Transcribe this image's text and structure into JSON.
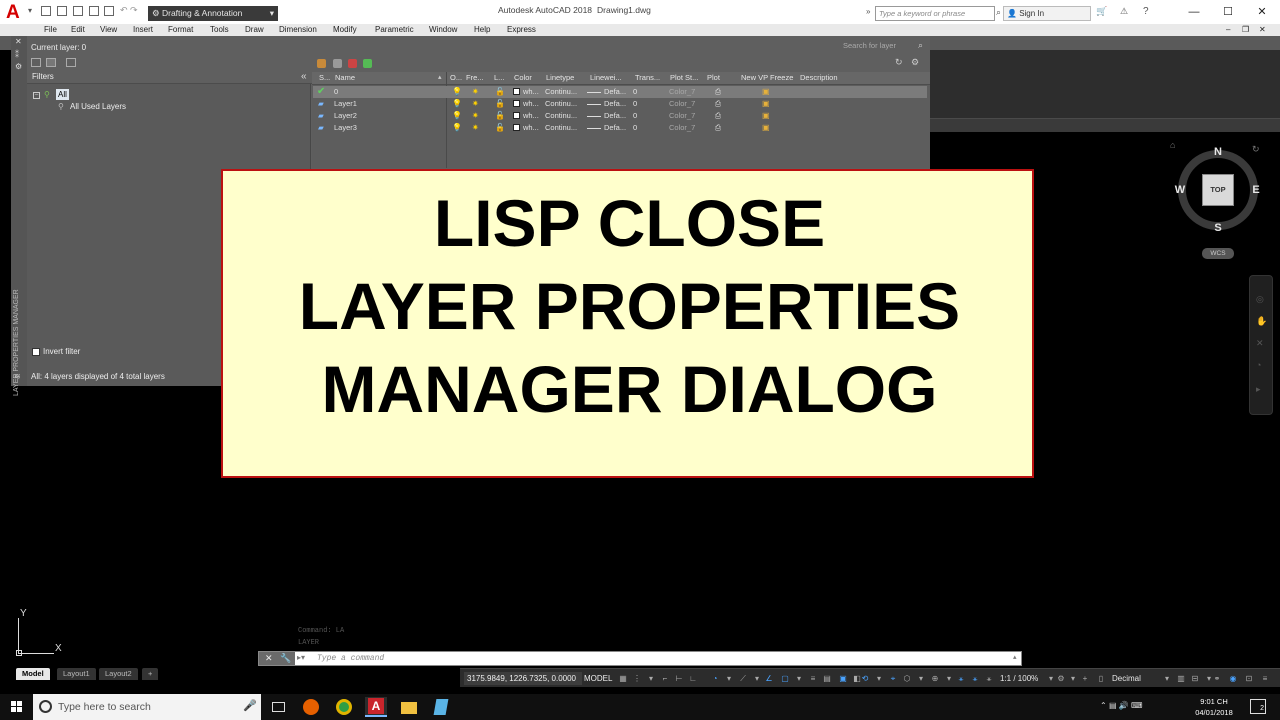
{
  "titlebar": {
    "workspace": "Drafting & Annotation",
    "app_title": "Autodesk AutoCAD 2018",
    "document": "Drawing1.dwg",
    "search_placeholder": "Type a keyword or phrase",
    "signin": "Sign In",
    "minimize": "—",
    "maximize": "☐",
    "close": "✕"
  },
  "menu": [
    "File",
    "Edit",
    "View",
    "Insert",
    "Format",
    "Tools",
    "Draw",
    "Dimension",
    "Modify",
    "Parametric",
    "Window",
    "Help",
    "Express"
  ],
  "lpm": {
    "current_layer": "Current layer: 0",
    "search_placeholder": "Search for layer",
    "filters_label": "Filters",
    "collapse": "«",
    "filter_tree": {
      "all": "All",
      "all_used": "All Used Layers"
    },
    "invert_filter": "Invert filter",
    "status": "All: 4 layers displayed of 4 total layers",
    "side_title": "LAYER PROPERTIES MANAGER",
    "close_icon": "✕",
    "pin_icon": "⁑",
    "columns": [
      "S...",
      "Name",
      "O...",
      "Fre...",
      "L...",
      "Color",
      "Linetype",
      "Linewei...",
      "Trans...",
      "Plot St...",
      "Plot",
      "New VP Freeze",
      "Description"
    ],
    "layers": [
      {
        "name": "0",
        "current": true,
        "color": "wh...",
        "linetype": "Continu...",
        "lineweight": "Defa...",
        "transparency": "0",
        "plotstyle": "Color_7"
      },
      {
        "name": "Layer1",
        "current": false,
        "color": "wh...",
        "linetype": "Continu...",
        "lineweight": "Defa...",
        "transparency": "0",
        "plotstyle": "Color_7"
      },
      {
        "name": "Layer2",
        "current": false,
        "color": "wh...",
        "linetype": "Continu...",
        "lineweight": "Defa...",
        "transparency": "0",
        "plotstyle": "Color_7"
      },
      {
        "name": "Layer3",
        "current": false,
        "color": "wh...",
        "linetype": "Continu...",
        "lineweight": "Defa...",
        "transparency": "0",
        "plotstyle": "Color_7"
      }
    ]
  },
  "overlay": {
    "line1": "LISP CLOSE",
    "line2": "LAYER PROPERTIES",
    "line3": "MANAGER DIALOG"
  },
  "viewcube": {
    "n": "N",
    "s": "S",
    "e": "E",
    "w": "W",
    "face": "TOP",
    "wcs": "WCS"
  },
  "ucs": {
    "x": "X",
    "y": "Y"
  },
  "command": {
    "history1": "Command: LA",
    "history2": "LAYER",
    "placeholder": "Type a command"
  },
  "layout_tabs": [
    "Model",
    "Layout1",
    "Layout2",
    "+"
  ],
  "status": {
    "coords": "3175.9849, 1226.7325, 0.0000",
    "model": "MODEL",
    "scale": "1:1 / 100%",
    "units": "Decimal"
  },
  "taskbar": {
    "search": "Type here to search",
    "time": "9:01 CH",
    "date": "04/01/2018",
    "notif": "2"
  },
  "colors": {
    "accent_red": "#d40000",
    "overlay_bg": "#ffffcc",
    "overlay_border": "#bb1111"
  }
}
